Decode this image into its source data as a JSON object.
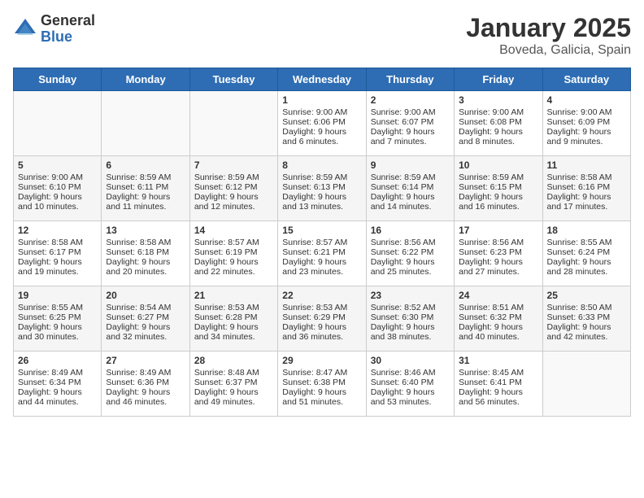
{
  "logo": {
    "general": "General",
    "blue": "Blue"
  },
  "title": "January 2025",
  "subtitle": "Boveda, Galicia, Spain",
  "days_of_week": [
    "Sunday",
    "Monday",
    "Tuesday",
    "Wednesday",
    "Thursday",
    "Friday",
    "Saturday"
  ],
  "weeks": [
    [
      {
        "day": "",
        "content": ""
      },
      {
        "day": "",
        "content": ""
      },
      {
        "day": "",
        "content": ""
      },
      {
        "day": "1",
        "content": "Sunrise: 9:00 AM\nSunset: 6:06 PM\nDaylight: 9 hours and 6 minutes."
      },
      {
        "day": "2",
        "content": "Sunrise: 9:00 AM\nSunset: 6:07 PM\nDaylight: 9 hours and 7 minutes."
      },
      {
        "day": "3",
        "content": "Sunrise: 9:00 AM\nSunset: 6:08 PM\nDaylight: 9 hours and 8 minutes."
      },
      {
        "day": "4",
        "content": "Sunrise: 9:00 AM\nSunset: 6:09 PM\nDaylight: 9 hours and 9 minutes."
      }
    ],
    [
      {
        "day": "5",
        "content": "Sunrise: 9:00 AM\nSunset: 6:10 PM\nDaylight: 9 hours and 10 minutes."
      },
      {
        "day": "6",
        "content": "Sunrise: 8:59 AM\nSunset: 6:11 PM\nDaylight: 9 hours and 11 minutes."
      },
      {
        "day": "7",
        "content": "Sunrise: 8:59 AM\nSunset: 6:12 PM\nDaylight: 9 hours and 12 minutes."
      },
      {
        "day": "8",
        "content": "Sunrise: 8:59 AM\nSunset: 6:13 PM\nDaylight: 9 hours and 13 minutes."
      },
      {
        "day": "9",
        "content": "Sunrise: 8:59 AM\nSunset: 6:14 PM\nDaylight: 9 hours and 14 minutes."
      },
      {
        "day": "10",
        "content": "Sunrise: 8:59 AM\nSunset: 6:15 PM\nDaylight: 9 hours and 16 minutes."
      },
      {
        "day": "11",
        "content": "Sunrise: 8:58 AM\nSunset: 6:16 PM\nDaylight: 9 hours and 17 minutes."
      }
    ],
    [
      {
        "day": "12",
        "content": "Sunrise: 8:58 AM\nSunset: 6:17 PM\nDaylight: 9 hours and 19 minutes."
      },
      {
        "day": "13",
        "content": "Sunrise: 8:58 AM\nSunset: 6:18 PM\nDaylight: 9 hours and 20 minutes."
      },
      {
        "day": "14",
        "content": "Sunrise: 8:57 AM\nSunset: 6:19 PM\nDaylight: 9 hours and 22 minutes."
      },
      {
        "day": "15",
        "content": "Sunrise: 8:57 AM\nSunset: 6:21 PM\nDaylight: 9 hours and 23 minutes."
      },
      {
        "day": "16",
        "content": "Sunrise: 8:56 AM\nSunset: 6:22 PM\nDaylight: 9 hours and 25 minutes."
      },
      {
        "day": "17",
        "content": "Sunrise: 8:56 AM\nSunset: 6:23 PM\nDaylight: 9 hours and 27 minutes."
      },
      {
        "day": "18",
        "content": "Sunrise: 8:55 AM\nSunset: 6:24 PM\nDaylight: 9 hours and 28 minutes."
      }
    ],
    [
      {
        "day": "19",
        "content": "Sunrise: 8:55 AM\nSunset: 6:25 PM\nDaylight: 9 hours and 30 minutes."
      },
      {
        "day": "20",
        "content": "Sunrise: 8:54 AM\nSunset: 6:27 PM\nDaylight: 9 hours and 32 minutes."
      },
      {
        "day": "21",
        "content": "Sunrise: 8:53 AM\nSunset: 6:28 PM\nDaylight: 9 hours and 34 minutes."
      },
      {
        "day": "22",
        "content": "Sunrise: 8:53 AM\nSunset: 6:29 PM\nDaylight: 9 hours and 36 minutes."
      },
      {
        "day": "23",
        "content": "Sunrise: 8:52 AM\nSunset: 6:30 PM\nDaylight: 9 hours and 38 minutes."
      },
      {
        "day": "24",
        "content": "Sunrise: 8:51 AM\nSunset: 6:32 PM\nDaylight: 9 hours and 40 minutes."
      },
      {
        "day": "25",
        "content": "Sunrise: 8:50 AM\nSunset: 6:33 PM\nDaylight: 9 hours and 42 minutes."
      }
    ],
    [
      {
        "day": "26",
        "content": "Sunrise: 8:49 AM\nSunset: 6:34 PM\nDaylight: 9 hours and 44 minutes."
      },
      {
        "day": "27",
        "content": "Sunrise: 8:49 AM\nSunset: 6:36 PM\nDaylight: 9 hours and 46 minutes."
      },
      {
        "day": "28",
        "content": "Sunrise: 8:48 AM\nSunset: 6:37 PM\nDaylight: 9 hours and 49 minutes."
      },
      {
        "day": "29",
        "content": "Sunrise: 8:47 AM\nSunset: 6:38 PM\nDaylight: 9 hours and 51 minutes."
      },
      {
        "day": "30",
        "content": "Sunrise: 8:46 AM\nSunset: 6:40 PM\nDaylight: 9 hours and 53 minutes."
      },
      {
        "day": "31",
        "content": "Sunrise: 8:45 AM\nSunset: 6:41 PM\nDaylight: 9 hours and 56 minutes."
      },
      {
        "day": "",
        "content": ""
      }
    ]
  ]
}
